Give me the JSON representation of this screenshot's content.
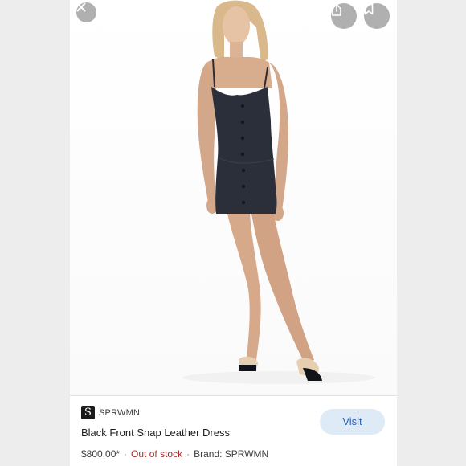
{
  "product": {
    "brand": "SPRWMN",
    "brand_logo_letter": "S",
    "title": "Black Front Snap Leather Dress",
    "price": "$800.00*",
    "stock_status": "Out of stock",
    "brand_meta": "Brand: SPRWMN",
    "separator": "·"
  },
  "actions": {
    "visit_label": "Visit"
  },
  "icons": {
    "close": "close-icon",
    "share": "share-icon",
    "save": "bookmark-icon"
  },
  "colors": {
    "stock_status": "#a32d2d",
    "visit_button_bg": "#dfeaf7",
    "visit_button_text": "#2a62b4"
  }
}
